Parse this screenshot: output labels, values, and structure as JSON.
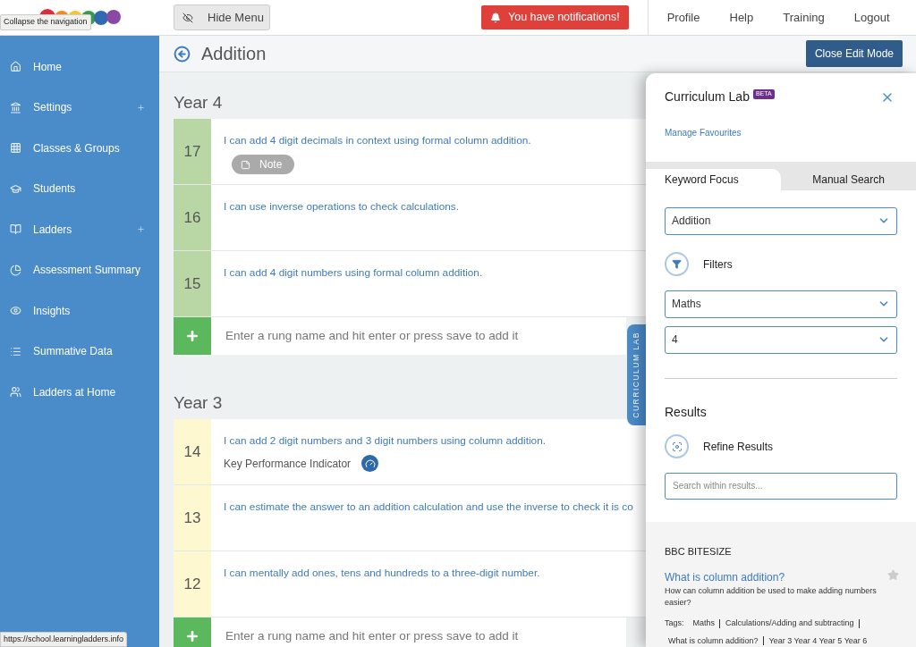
{
  "header": {
    "hide_menu": "Hide Menu",
    "notification": "You have notifications!",
    "links": [
      "Profile",
      "Help",
      "Training",
      "Logout"
    ]
  },
  "tooltip": "Collapse the navigation",
  "status_url": "https://school.learningladders.info",
  "sidebar": {
    "items": [
      {
        "label": "Home",
        "expandable": false
      },
      {
        "label": "Settings",
        "expandable": true
      },
      {
        "label": "Classes & Groups",
        "expandable": false
      },
      {
        "label": "Students",
        "expandable": false
      },
      {
        "label": "Ladders",
        "expandable": true
      },
      {
        "label": "Assessment Summary",
        "expandable": false
      },
      {
        "label": "Insights",
        "expandable": false
      },
      {
        "label": "Summative Data",
        "expandable": false
      },
      {
        "label": "Ladders at Home",
        "expandable": false
      }
    ]
  },
  "page": {
    "title": "Addition",
    "close_edit": "Close Edit Mode"
  },
  "sections": [
    {
      "title": "Year 4",
      "color": "#b9d6a5",
      "rungs": [
        {
          "number": "17",
          "text": "I can add 4 digit decimals in context using formal column addition.",
          "note": "Note"
        },
        {
          "number": "16",
          "text": "I can use inverse operations to check calculations."
        },
        {
          "number": "15",
          "text": "I can add 4 digit numbers using formal column addition."
        }
      ],
      "add_placeholder": "Enter a rung name and hit enter or press save to add it"
    },
    {
      "title": "Year 3",
      "color": "#fdf8d0",
      "rungs": [
        {
          "number": "14",
          "text": "I can add 2 digit numbers and 3 digit numbers using column addition.",
          "kpi": "Key Performance Indicator"
        },
        {
          "number": "13",
          "text": "I can estimate the answer to an addition calculation and use the inverse to check it is co"
        },
        {
          "number": "12",
          "text": "I can mentally add ones, tens and hundreds to a three-digit number."
        }
      ],
      "add_placeholder": "Enter a rung name and hit enter or press save to add it"
    }
  ],
  "lab": {
    "tab_label": "CURRICULUM LAB",
    "title": "Curriculum Lab",
    "badge": "BETA",
    "manage": "Manage Favourites",
    "tabs": [
      {
        "label": "Keyword Focus",
        "selected": true
      },
      {
        "label": "Manual Search",
        "selected": false
      }
    ],
    "keyword": "Addition",
    "filters_label": "Filters",
    "subject": "Maths",
    "year": "4",
    "results_title": "Results",
    "refine": "Refine Results",
    "search_placeholder": "Search within results...",
    "source": "BBC BITESIZE",
    "result": {
      "title": "What is column addition?",
      "description": "How can column addition be used to make adding numbers easier?",
      "favourite": false,
      "tags_label": "Tags:",
      "tags": [
        "Maths",
        "Calculations/Adding and subtracting",
        "What is column addition?",
        "Year 3 Year 4 Year 5 Year 6"
      ]
    }
  }
}
